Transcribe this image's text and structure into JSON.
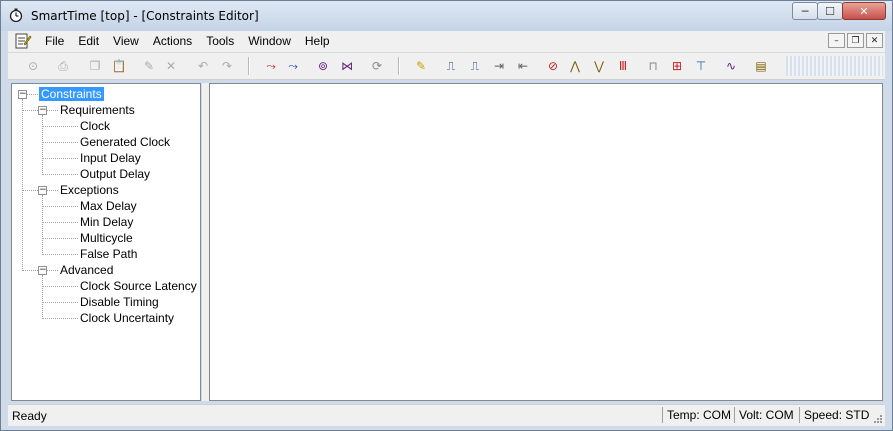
{
  "window": {
    "title": "SmartTime [top] - [Constraints Editor]",
    "caption_min": "─",
    "caption_max": "☐",
    "caption_close": "✕"
  },
  "menu": {
    "items": [
      "File",
      "Edit",
      "View",
      "Actions",
      "Tools",
      "Window",
      "Help"
    ]
  },
  "mdi": {
    "min": "–",
    "restore": "❐",
    "close": "✕"
  },
  "tree": {
    "root": "Constraints",
    "groups": [
      {
        "label": "Requirements",
        "children": [
          "Clock",
          "Generated Clock",
          "Input Delay",
          "Output Delay"
        ]
      },
      {
        "label": "Exceptions",
        "children": [
          "Max Delay",
          "Min Delay",
          "Multicycle",
          "False Path"
        ]
      },
      {
        "label": "Advanced",
        "children": [
          "Clock Source Latency",
          "Disable Timing",
          "Clock Uncertainty"
        ]
      }
    ]
  },
  "status": {
    "left": "Ready",
    "temp": "Temp: COM",
    "volt": "Volt: COM",
    "speed": "Speed: STD"
  },
  "colors": {
    "selection": "#3399ff",
    "title_gradient_top": "#dfe9f5",
    "close_red": "#c75050"
  }
}
